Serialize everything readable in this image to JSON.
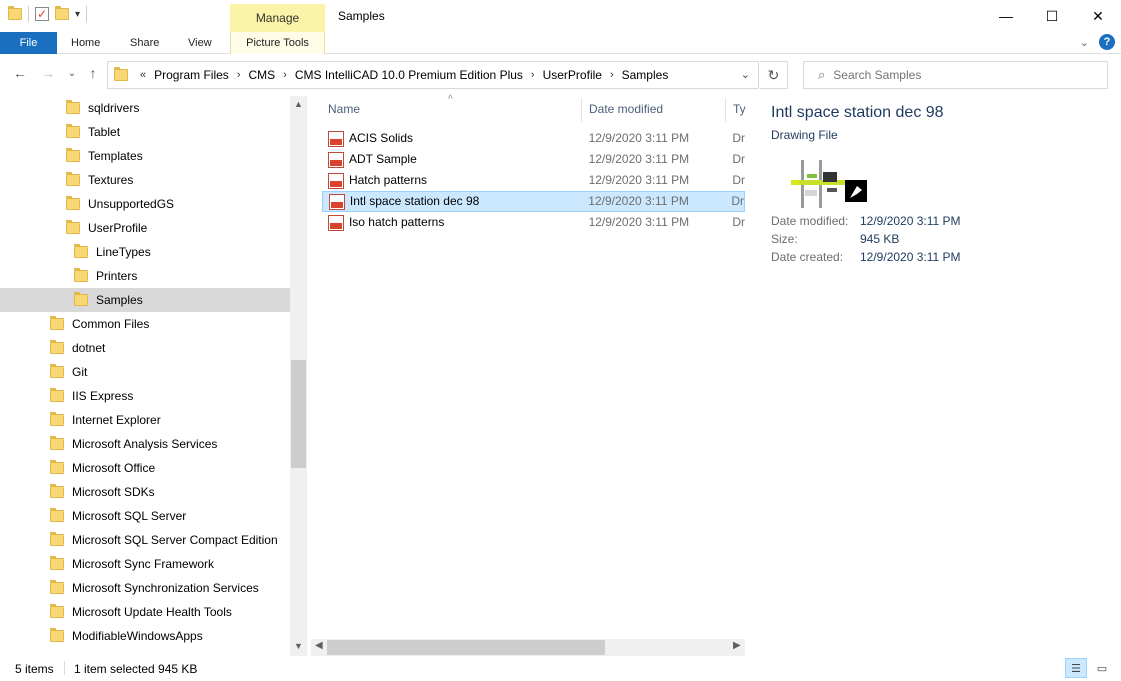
{
  "window": {
    "title": "Samples",
    "contextual_tab": "Manage"
  },
  "ribbon": {
    "tabs": [
      "File",
      "Home",
      "Share",
      "View",
      "Picture Tools"
    ]
  },
  "address": {
    "overflow": "«",
    "crumbs": [
      "Program Files",
      "CMS",
      "CMS IntelliCAD 10.0 Premium Edition Plus",
      "UserProfile",
      "Samples"
    ]
  },
  "search": {
    "placeholder": "Search Samples"
  },
  "nav_items": [
    "sqldrivers",
    "Tablet",
    "Templates",
    "Textures",
    "UnsupportedGS",
    "UserProfile",
    "LineTypes",
    "Printers",
    "Samples",
    "Common Files",
    "dotnet",
    "Git",
    "IIS Express",
    "Internet Explorer",
    "Microsoft Analysis Services",
    "Microsoft Office",
    "Microsoft SDKs",
    "Microsoft SQL Server",
    "Microsoft SQL Server Compact Edition",
    "Microsoft Sync Framework",
    "Microsoft Synchronization Services",
    "Microsoft Update Health Tools",
    "ModifiableWindowsApps"
  ],
  "columns": {
    "name": "Name",
    "date": "Date modified",
    "type": "Ty"
  },
  "files": [
    {
      "name": "ACIS Solids",
      "date": "12/9/2020 3:11 PM",
      "type": "Dr"
    },
    {
      "name": "ADT Sample",
      "date": "12/9/2020 3:11 PM",
      "type": "Dr"
    },
    {
      "name": "Hatch patterns",
      "date": "12/9/2020 3:11 PM",
      "type": "Dr"
    },
    {
      "name": "Intl space station dec 98",
      "date": "12/9/2020 3:11 PM",
      "type": "Dr"
    },
    {
      "name": "Iso hatch patterns",
      "date": "12/9/2020 3:11 PM",
      "type": "Dr"
    }
  ],
  "preview": {
    "title": "Intl space station dec 98",
    "type": "Drawing File",
    "date_modified_label": "Date modified:",
    "date_modified": "12/9/2020 3:11 PM",
    "size_label": "Size:",
    "size": "945 KB",
    "date_created_label": "Date created:",
    "date_created": "12/9/2020 3:11 PM"
  },
  "status": {
    "items": "5 items",
    "selected": "1 item selected  945 KB"
  },
  "colors": {
    "accent": "#1a6fc1",
    "selection": "#cce8ff",
    "manage": "#fbf4a8"
  }
}
